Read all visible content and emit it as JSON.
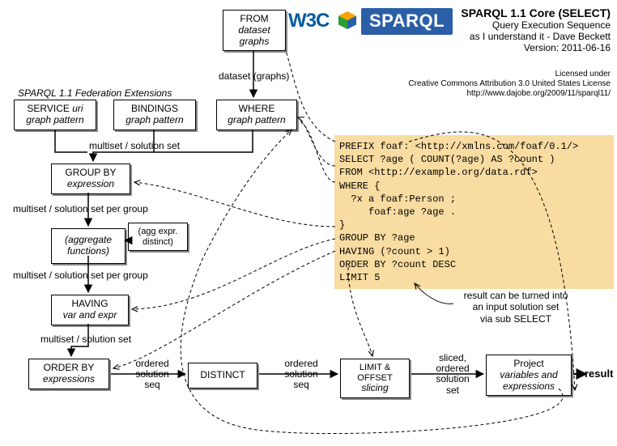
{
  "header": {
    "title": "SPARQL 1.1 Core (SELECT)",
    "subtitle": "Query Execution Sequence",
    "credit": "as I understand it - Dave Beckett",
    "version": "Version: 2011-06-16",
    "license_line1": "Licensed under",
    "license_line2": "Creative Commons Attribution 3.0 United States License",
    "license_line3": "http://www.dajobe.org/2009/11/sparql11/"
  },
  "logos": {
    "w3c_text": "W3C",
    "sparql_text": "SPARQL"
  },
  "boxes": {
    "from": {
      "title": "FROM",
      "italic": "dataset graphs"
    },
    "service": {
      "title_prefix": "SERVICE ",
      "title_italic": "uri",
      "italic": "graph pattern"
    },
    "bindings": {
      "title": "BINDINGS",
      "italic": "graph pattern"
    },
    "where": {
      "title": "WHERE",
      "italic": "graph pattern"
    },
    "groupby": {
      "title": "GROUP BY",
      "italic": "expression"
    },
    "agg": {
      "italic": "(aggregate functions)"
    },
    "aggnote": {
      "text_line1": "(agg expr.",
      "text_line2": "distinct)"
    },
    "having": {
      "title": "HAVING",
      "italic": "var and expr"
    },
    "orderby": {
      "title": "ORDER BY",
      "italic": "expressions"
    },
    "distinct": {
      "title": "DISTINCT"
    },
    "limit": {
      "title": "LIMIT & OFFSET",
      "italic": "slicing"
    },
    "project": {
      "title": "Project",
      "italic": "variables and expressions"
    }
  },
  "labels": {
    "fed_ext": "SPARQL 1.1 Federation Extensions",
    "dataset_graphs": "dataset (graphs)",
    "ms_solset": "multiset / solution set",
    "ms_per_group": "multiset / solution set per group",
    "ordered_seq": "ordered\nsolution\nseq",
    "sliced_seq": "sliced,\nordered\nsolution\nset",
    "result": "result",
    "sub_select": "result can be turned into\nan input solution set\nvia sub SELECT"
  },
  "code": {
    "l1": "PREFIX foaf: <http://xmlns.com/foaf/0.1/>",
    "l2": "SELECT ?age ( COUNT(?age) AS ?count )",
    "l3": "FROM <http://example.org/data.rdf>",
    "l4": "WHERE {",
    "l5": "  ?x a foaf:Person ;",
    "l6": "     foaf:age ?age .",
    "l7": "}",
    "l8": "GROUP BY ?age",
    "l9": "HAVING (?count > 1)",
    "l10": "ORDER BY ?count DESC",
    "l11": "LIMIT 5"
  }
}
